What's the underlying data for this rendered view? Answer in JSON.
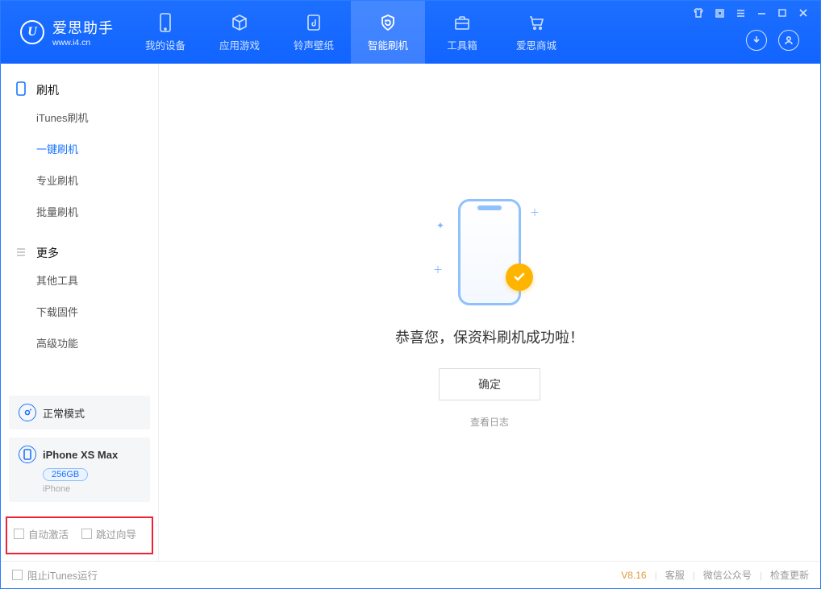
{
  "app": {
    "name_cn": "爱思助手",
    "url": "www.i4.cn",
    "logo_letter": "U"
  },
  "nav": {
    "items": [
      {
        "label": "我的设备"
      },
      {
        "label": "应用游戏"
      },
      {
        "label": "铃声壁纸"
      },
      {
        "label": "智能刷机"
      },
      {
        "label": "工具箱"
      },
      {
        "label": "爱思商城"
      }
    ],
    "active_index": 3
  },
  "sidebar": {
    "group1": {
      "title": "刷机",
      "items": [
        {
          "label": "iTunes刷机"
        },
        {
          "label": "一键刷机"
        },
        {
          "label": "专业刷机"
        },
        {
          "label": "批量刷机"
        }
      ],
      "active_index": 1
    },
    "group2": {
      "title": "更多",
      "items": [
        {
          "label": "其他工具"
        },
        {
          "label": "下载固件"
        },
        {
          "label": "高级功能"
        }
      ]
    },
    "mode_card": {
      "label": "正常模式"
    },
    "device_card": {
      "name": "iPhone XS Max",
      "capacity": "256GB",
      "kind": "iPhone"
    },
    "redbox": {
      "opt1": "自动激活",
      "opt2": "跳过向导"
    }
  },
  "main": {
    "message": "恭喜您，保资料刷机成功啦！",
    "ok": "确定",
    "log": "查看日志"
  },
  "status": {
    "block_itunes": "阻止iTunes运行",
    "version": "V8.16",
    "links": [
      "客服",
      "微信公众号",
      "检查更新"
    ]
  }
}
